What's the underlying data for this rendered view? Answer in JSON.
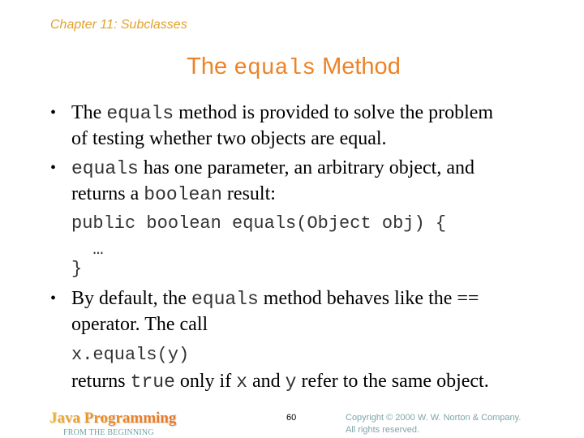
{
  "header": {
    "chapter": "Chapter 11: Subclasses",
    "title_pre": "The ",
    "title_code": "equals",
    "title_post": " Method"
  },
  "bullets": [
    {
      "lines": [
        {
          "pre": "The ",
          "code": "equals",
          "post": " method is provided to solve the problem"
        },
        {
          "pre": "of testing whether two objects are equal."
        }
      ]
    },
    {
      "lines": [
        {
          "pre": "",
          "code": "equals",
          "post": " has one parameter, an arbitrary object, and"
        },
        {
          "pre": "returns a ",
          "code": "boolean",
          "post": " result:"
        }
      ],
      "code_block": [
        "public boolean equals(Object obj) {",
        "  …",
        "}"
      ]
    },
    {
      "lines": [
        {
          "pre": "By default, the ",
          "code": "equals",
          "post": " method behaves like the =="
        },
        {
          "pre": "operator. The call"
        },
        {
          "code_only": "x.equals(y)"
        },
        {
          "pre": "returns ",
          "code": "true",
          "mid": " only if ",
          "code2": "x",
          "mid2": " and ",
          "code3": "y",
          "post": " refer to the same object."
        }
      ]
    }
  ],
  "footer": {
    "logo": "Java Programming",
    "subtitle": "FROM THE BEGINNING",
    "page_number": "60",
    "copyright_line1": "Copyright © 2000 W. W. Norton & Company.",
    "copyright_line2": "All rights reserved."
  },
  "colors": {
    "chapter": "#e0a22a",
    "title": "#ee8224",
    "footer_subtitle": "#6fa2a6",
    "copyright": "#7fa5a8"
  }
}
